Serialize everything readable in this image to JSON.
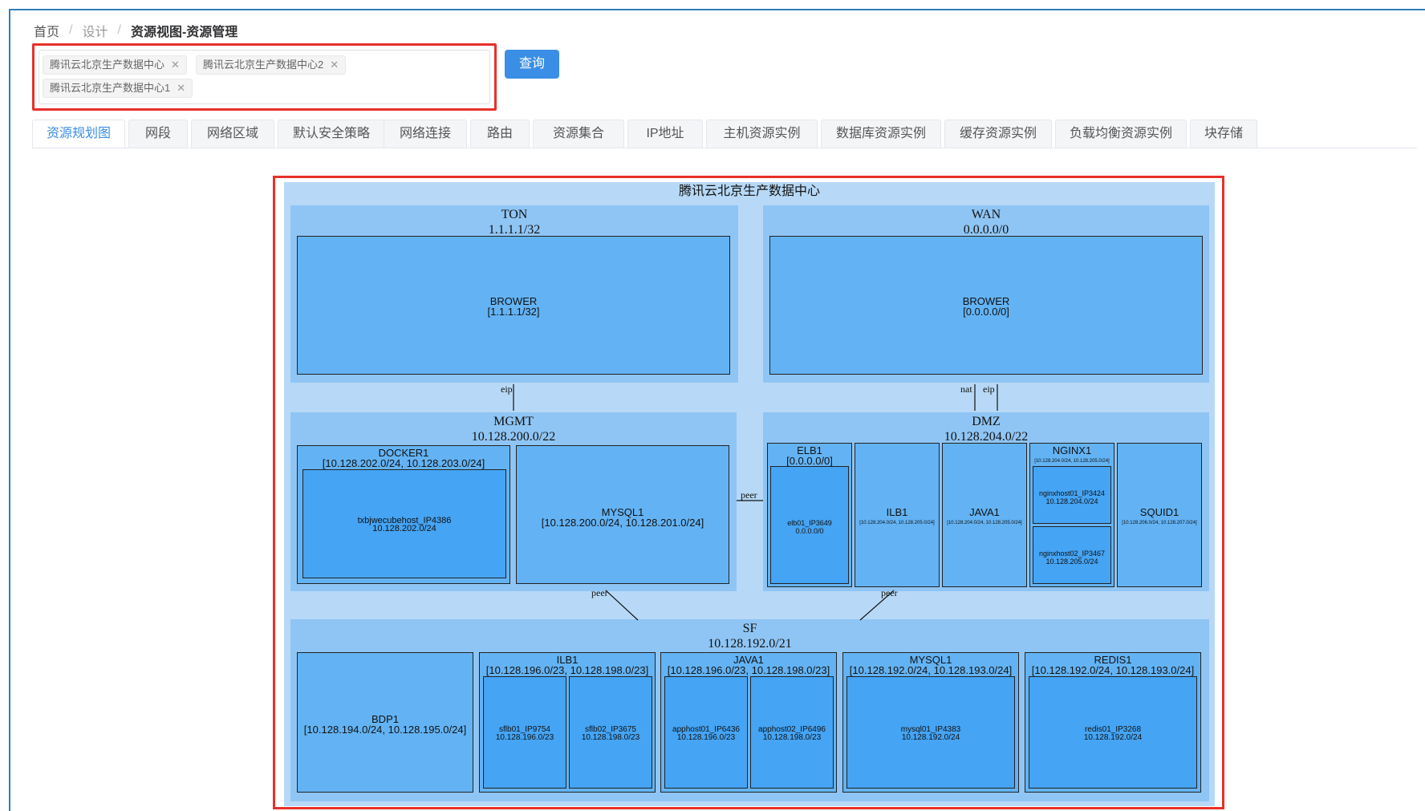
{
  "breadcrumb": {
    "home": "首页",
    "design": "设计",
    "current": "资源视图-资源管理"
  },
  "selected_tags": [
    "腾讯云北京生产数据中心",
    "腾讯云北京生产数据中心2",
    "腾讯云北京生产数据中心1"
  ],
  "query_button": "查询",
  "tabs": [
    "资源规划图",
    "网段",
    "网络区域",
    "默认安全策略",
    "网络连接",
    "路由",
    "资源集合",
    "IP地址",
    "主机资源实例",
    "数据库资源实例",
    "缓存资源实例",
    "负载均衡资源实例",
    "块存储"
  ],
  "active_tab": "资源规划图",
  "diagram": {
    "title": "腾讯云北京生产数据中心",
    "ton": {
      "name": "TON",
      "cidr": "1.1.1.1/32",
      "brower": "BROWER",
      "brower_cidr": "[1.1.1.1/32]"
    },
    "wan": {
      "name": "WAN",
      "cidr": "0.0.0.0/0",
      "brower": "BROWER",
      "brower_cidr": "[0.0.0.0/0]"
    },
    "mgmt": {
      "name": "MGMT",
      "cidr": "10.128.200.0/22",
      "docker": {
        "name": "DOCKER1",
        "cidr": "[10.128.202.0/24, 10.128.203.0/24]",
        "host": "txbjwecubehost_IP4386",
        "host_ip": "10.128.202.0/24"
      },
      "mysql": {
        "name": "MYSQL1",
        "cidr": "[10.128.200.0/24, 10.128.201.0/24]"
      }
    },
    "dmz": {
      "name": "DMZ",
      "cidr": "10.128.204.0/22",
      "elb": {
        "name": "ELB1",
        "cidr": "[0.0.0.0/0]",
        "host": "elb01_IP3649",
        "host_ip": "0.0.0.0/0"
      },
      "ilb": {
        "name": "ILB1",
        "cidr": "[10.128.204.0/24, 10.128.205.0/24]"
      },
      "java": {
        "name": "JAVA1",
        "cidr": "[10.128.204.0/24, 10.128.205.0/24]"
      },
      "nginx": {
        "name": "NGINX1",
        "cidr": "[10.128.204.0/24, 10.128.205.0/24]",
        "host1": "nginxhost01_IP3424",
        "host1_ip": "10.128.204.0/24",
        "host2": "nginxhost02_IP3467",
        "host2_ip": "10.128.205.0/24"
      },
      "squid": {
        "name": "SQUID1",
        "cidr": "[10.128.206.0/24, 10.128.207.0/24]"
      }
    },
    "sf": {
      "name": "SF",
      "cidr": "10.128.192.0/21",
      "bdp": {
        "name": "BDP1",
        "cidr": "[10.128.194.0/24, 10.128.195.0/24]"
      },
      "ilb": {
        "name": "ILB1",
        "cidr": "[10.128.196.0/23, 10.128.198.0/23]",
        "host1": "sflb01_IP9754",
        "host1_ip": "10.128.196.0/23",
        "host2": "sflb02_IP3675",
        "host2_ip": "10.128.198.0/23"
      },
      "java": {
        "name": "JAVA1",
        "cidr": "[10.128.196.0/23, 10.128.198.0/23]",
        "host1": "apphost01_IP6436",
        "host1_ip": "10.128.196.0/23",
        "host2": "apphost02_IP6496",
        "host2_ip": "10.128.198.0/23"
      },
      "mysql": {
        "name": "MYSQL1",
        "cidr": "[10.128.192.0/24, 10.128.193.0/24]",
        "host": "mysql01_IP4383",
        "host_ip": "10.128.192.0/24"
      },
      "redis": {
        "name": "REDIS1",
        "cidr": "[10.128.192.0/24, 10.128.193.0/24]",
        "host": "redis01_IP3268",
        "host_ip": "10.128.192.0/24"
      }
    },
    "links": {
      "eip": "eip",
      "nat": "nat",
      "peer": "peer"
    }
  },
  "colors": {
    "accent": "#3a8ee6",
    "highlight_border": "#e8302a",
    "outer": "#b7d9f7",
    "zone": "#8fc5f4",
    "level1": "#63b3f4",
    "level2": "#45a4f4",
    "level3": "#2f97f0"
  }
}
